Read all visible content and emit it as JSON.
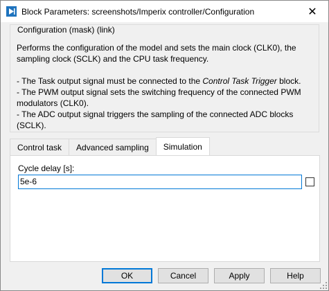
{
  "window": {
    "title": "Block Parameters: screenshots/Imperix controller/Configuration",
    "close_glyph": "✕"
  },
  "group": {
    "title": "Configuration (mask) (link)",
    "paragraph": "Performs the configuration of the model and sets the main clock (CLK0), the sampling clock (SCLK) and the CPU task frequency.",
    "bullet1_prefix": "- The Task output signal must be connected to the ",
    "bullet1_italic": "Control Task Trigger",
    "bullet1_suffix": " block.",
    "bullet2": "- The PWM output signal sets the switching frequency of the connected PWM modulators (CLK0).",
    "bullet3": "- The ADC output signal triggers the sampling of the connected ADC blocks (SCLK)."
  },
  "tabs": [
    {
      "label": "Control task",
      "active": false
    },
    {
      "label": "Advanced sampling",
      "active": false
    },
    {
      "label": "Simulation",
      "active": true
    }
  ],
  "simulation": {
    "cycle_delay_label": "Cycle delay [s]:",
    "cycle_delay_value": "5e-6",
    "checkbox_checked": false
  },
  "buttons": {
    "ok": "OK",
    "cancel": "Cancel",
    "apply": "Apply",
    "help": "Help"
  },
  "colors": {
    "accent": "#0078d7",
    "app_icon": "#1e73be"
  },
  "icons": {
    "app": "simulink-block-icon",
    "close": "close-icon",
    "grip": "resize-grip-icon"
  }
}
